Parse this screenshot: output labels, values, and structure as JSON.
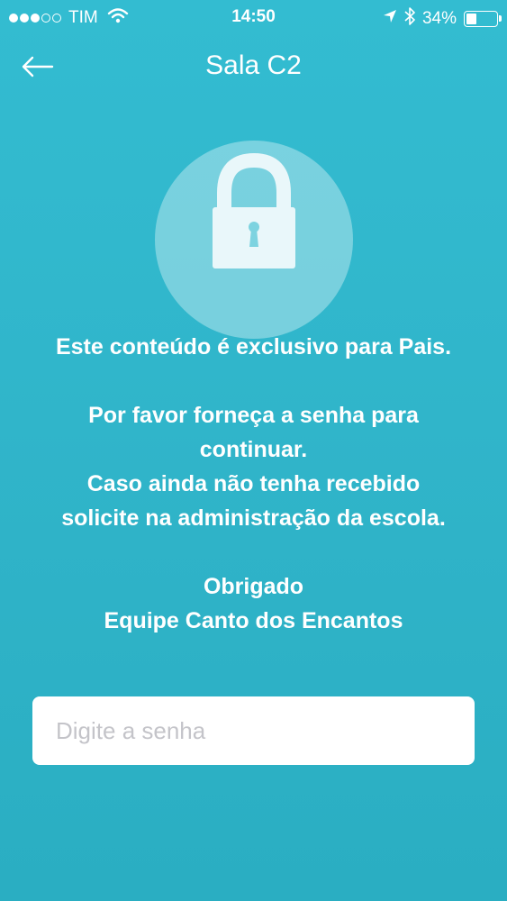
{
  "status_bar": {
    "carrier": "TIM",
    "time": "14:50",
    "battery_text": "34%",
    "battery_level": 0.34,
    "signal_bars": 3,
    "signal_max": 5
  },
  "nav": {
    "title": "Sala C2"
  },
  "message": {
    "line1": "Este conteúdo é exclusivo para Pais.",
    "line2": "Por favor forneça a senha para",
    "line3": "continuar.",
    "line4": "Caso ainda não tenha recebido",
    "line5": "solicite na administração da escola.",
    "line6": "Obrigado",
    "line7": "Equipe Canto dos Encantos"
  },
  "password": {
    "placeholder": "Digite a senha",
    "value": ""
  },
  "colors": {
    "background": "#33bcd1",
    "text": "#ffffff",
    "input_background": "#ffffff",
    "placeholder": "#c4c4c9"
  },
  "icons": {
    "back": "arrow-left-icon",
    "lock": "lock-icon",
    "wifi": "wifi-icon",
    "location": "location-arrow-icon",
    "bluetooth": "bluetooth-icon",
    "battery": "battery-icon"
  }
}
